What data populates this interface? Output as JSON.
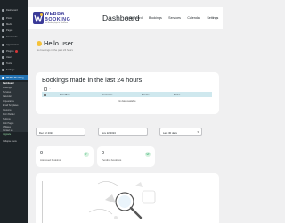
{
  "sidebar": {
    "items": [
      {
        "label": "Dashboard"
      },
      {
        "label": "Posts"
      },
      {
        "label": "Media"
      },
      {
        "label": "Pages"
      },
      {
        "label": "Comments"
      },
      {
        "label": "Appearance"
      },
      {
        "label": "Plugins"
      },
      {
        "label": "Users"
      },
      {
        "label": "Tools"
      },
      {
        "label": "Settings"
      },
      {
        "label": "Webba Booking"
      }
    ],
    "submenu": [
      {
        "label": "Dashboard"
      },
      {
        "label": "Bookings"
      },
      {
        "label": "Services"
      },
      {
        "label": "Calendar"
      },
      {
        "label": "Appearance"
      },
      {
        "label": "Email Templates"
      },
      {
        "label": "Coupons"
      },
      {
        "label": "Form Builder"
      },
      {
        "label": "Settings"
      },
      {
        "label": "Web Pages"
      },
      {
        "label": "Affiliates"
      },
      {
        "label": "Contact us"
      },
      {
        "label": "Upgrade"
      }
    ],
    "collapse_label": "Collapse menu"
  },
  "header": {
    "logo_word1": "WEBBA",
    "logo_word2": "BOOKING",
    "logo_tagline": "Best Booking plugin for WordPress",
    "title": "Dashboard",
    "nav": [
      "Dashboard",
      "Bookings",
      "Services",
      "Calendar",
      "Settings"
    ]
  },
  "greeting": {
    "title": "Hello user",
    "subtitle": "No bookings in the past 24 hours"
  },
  "bookings": {
    "title": "Bookings made in the last 24 hours",
    "select_label": "...",
    "columns": [
      "Date/Time",
      "Customer",
      "Service",
      "Status"
    ],
    "empty": "No data available"
  },
  "filters": {
    "date_from": "Dec 22 2024",
    "date_to": "Nov 22 2024",
    "range": "Last 30 days"
  },
  "stats": {
    "approved": {
      "value": "0",
      "label": "Approved bookings"
    },
    "pending": {
      "value": "0",
      "label": "Pending bookings"
    }
  },
  "colors": {
    "accent": "#2271b1",
    "brand": "#3b3b98",
    "table_header": "#cfe8ee",
    "wp_sidebar": "#1d2327"
  }
}
